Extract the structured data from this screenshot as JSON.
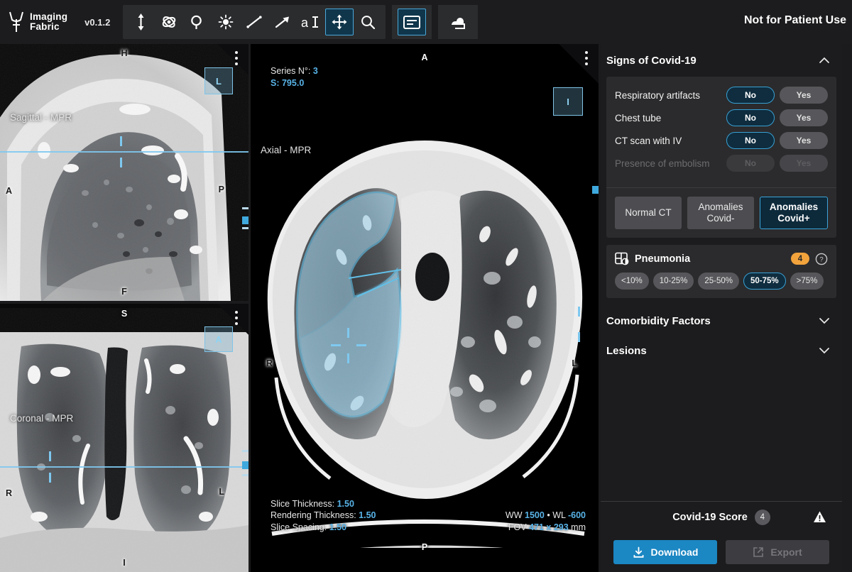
{
  "app": {
    "brand_line1": "Imaging",
    "brand_line2": "Fabric",
    "version": "v0.1.2",
    "disclaimer": "Not for Patient Use",
    "accent": "#3ba3d6",
    "primary_button": "#1b87c3",
    "badge_orange": "#f2a33c"
  },
  "toolbar": {
    "tools": [
      {
        "name": "scroll-stack-icon",
        "label": "Scroll"
      },
      {
        "name": "rotate-3d-icon",
        "label": "Rotate 3D"
      },
      {
        "name": "pan-icon",
        "label": "Pan"
      },
      {
        "name": "windowing-icon",
        "label": "Window Level"
      },
      {
        "name": "length-measure-icon",
        "label": "Length"
      },
      {
        "name": "arrow-annotate-icon",
        "label": "Arrow Annotation"
      },
      {
        "name": "text-annotate-icon",
        "label": "Text Annotation"
      },
      {
        "name": "crosshair-move-icon",
        "label": "Crosshair",
        "active": true
      },
      {
        "name": "magnify-icon",
        "label": "Magnify"
      }
    ],
    "layout_tool": {
      "name": "layout-panel-icon",
      "label": "Layout",
      "active": true
    },
    "series_tool": {
      "name": "series-stack-icon",
      "label": "Series"
    }
  },
  "viewports": {
    "sagittal": {
      "name": "Sagittal - MPR",
      "orient_top": "H",
      "orient_left": "A",
      "orient_right": "P",
      "orient_bottom": "F",
      "minimap_letter": "L"
    },
    "coronal": {
      "name": "Coronal - MPR",
      "orient_top": "S",
      "orient_left": "R",
      "orient_right": "L",
      "orient_bottom": "I",
      "minimap_letter": "A"
    },
    "axial": {
      "name": "Axial - MPR",
      "orient_top": "A",
      "orient_left": "R",
      "orient_right": "L",
      "orient_bottom": "P",
      "minimap_letter": "I",
      "series_label": "Series N°:",
      "series_value": "3",
      "slice_label": "S:",
      "slice_value": "795.0",
      "slice_thickness_label": "Slice Thickness:",
      "slice_thickness_value": "1.50",
      "rendering_thickness_label": "Rendering Thickness:",
      "rendering_thickness_value": "1.50",
      "slice_spacing_label": "Slice Spacing:",
      "slice_spacing_value": "1.50",
      "ww_label": "WW",
      "ww_value": "1500",
      "wl_label": "WL",
      "wl_value": "-600",
      "fov_label": "FOV",
      "fov_value": "471 x 293",
      "fov_unit": "mm",
      "dot_sep": "•"
    }
  },
  "panel": {
    "signs": {
      "title": "Signs of Covid-19",
      "expanded": true,
      "questions": [
        {
          "label": "Respiratory artifacts",
          "no": "No",
          "yes": "Yes",
          "selected": "No",
          "disabled": false
        },
        {
          "label": "Chest tube",
          "no": "No",
          "yes": "Yes",
          "selected": "No",
          "disabled": false
        },
        {
          "label": "CT scan with IV",
          "no": "No",
          "yes": "Yes",
          "selected": "No",
          "disabled": false
        },
        {
          "label": "Presence of embolism",
          "no": "No",
          "yes": "Yes",
          "selected": "",
          "disabled": true
        }
      ],
      "classification": [
        {
          "label": "Normal CT",
          "selected": false
        },
        {
          "label": "Anomalies Covid-",
          "line1": "Anomalies",
          "line2": "Covid-",
          "selected": false
        },
        {
          "label": "Anomalies Covid+",
          "line1": "Anomalies",
          "line2": "Covid+",
          "selected": true
        }
      ]
    },
    "pneumonia": {
      "title": "Pneumonia",
      "icon": "pneumonia-extent-icon",
      "badge": "4",
      "help": "help-icon",
      "options": [
        {
          "label": "<10%",
          "selected": false
        },
        {
          "label": "10-25%",
          "selected": false
        },
        {
          "label": "25-50%",
          "selected": false
        },
        {
          "label": "50-75%",
          "selected": true
        },
        {
          "label": ">75%",
          "selected": false
        }
      ]
    },
    "comorbidity": {
      "title": "Comorbidity Factors",
      "expanded": false
    },
    "lesions": {
      "title": "Lesions",
      "expanded": false
    },
    "footer": {
      "score_label": "Covid-19 Score",
      "score_value": "4",
      "warning_icon": "warning-triangle-icon",
      "download_label": "Download",
      "export_label": "Export",
      "export_disabled": true
    }
  }
}
